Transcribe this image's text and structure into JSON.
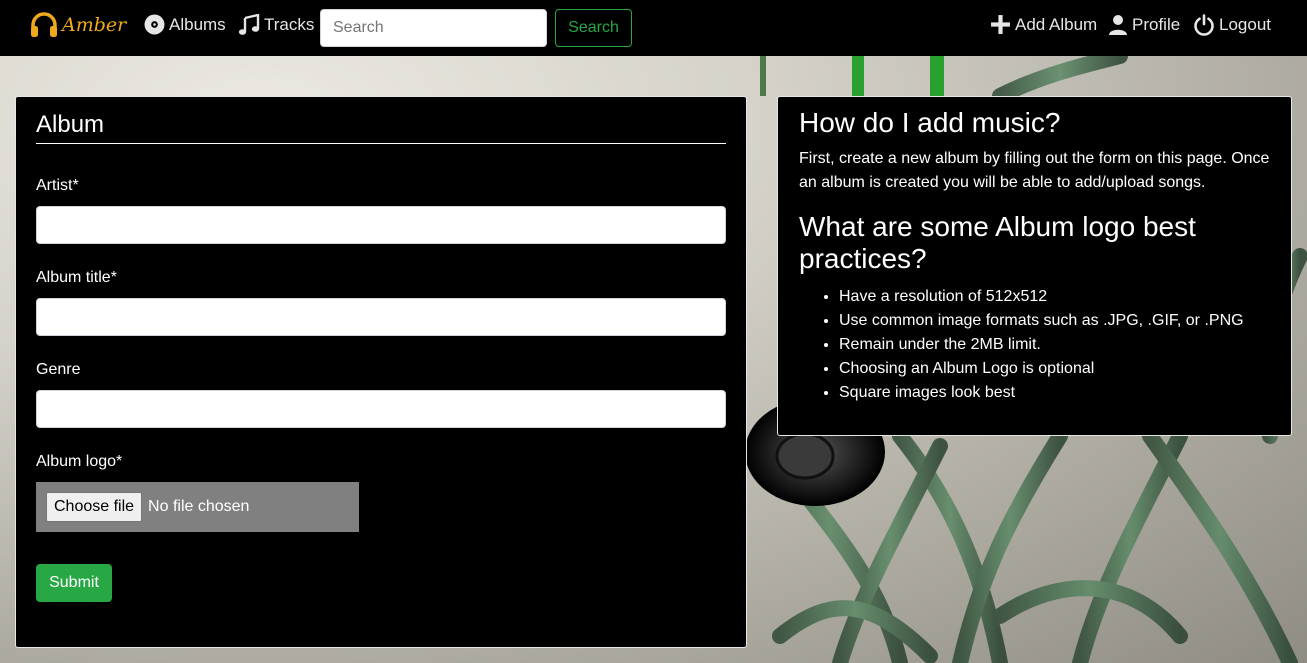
{
  "nav": {
    "brand": "Amber",
    "albums": "Albums",
    "tracks": "Tracks",
    "search_placeholder": "Search",
    "search_button": "Search",
    "add_album": "Add Album",
    "profile": "Profile",
    "logout": "Logout"
  },
  "form": {
    "title": "Album",
    "artist_label": "Artist*",
    "album_title_label": "Album title*",
    "genre_label": "Genre",
    "logo_label": "Album logo*",
    "choose_file": "Choose file",
    "file_status": "No file chosen",
    "submit": "Submit"
  },
  "help": {
    "q1": "How do I add music?",
    "a1": "First, create a new album by filling out the form on this page. Once an album is created you will be able to add/upload songs.",
    "q2": "What are some Album logo best practices?",
    "tips": [
      "Have a resolution of 512x512",
      "Use common image formats such as .JPG, .GIF, or .PNG",
      "Remain under the 2MB limit.",
      "Choosing an Album Logo is optional",
      "Square images look best"
    ]
  },
  "colors": {
    "brand": "#f0a81c",
    "accent_green": "#28a745",
    "navbar": "#000000",
    "panel": "#000000"
  }
}
